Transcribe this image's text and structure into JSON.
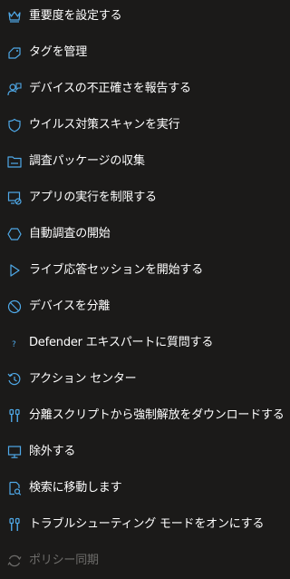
{
  "accent_color": "#4fa9e8",
  "menu": {
    "items": [
      {
        "label": "重要度を設定する",
        "icon": "crown-icon"
      },
      {
        "label": "タグを管理",
        "icon": "tag-icon"
      },
      {
        "label": "デバイスの不正確さを報告する",
        "icon": "report-user-icon"
      },
      {
        "label": "ウイルス対策スキャンを実行",
        "icon": "shield-icon"
      },
      {
        "label": "調査パッケージの収集",
        "icon": "folder-icon"
      },
      {
        "label": "アプリの実行を制限する",
        "icon": "restrict-app-icon"
      },
      {
        "label": "自動調査の開始",
        "icon": "hexagon-icon"
      },
      {
        "label": "ライブ応答セッションを開始する",
        "icon": "play-icon"
      },
      {
        "label": "デバイスを分離",
        "icon": "block-icon"
      },
      {
        "label": "Defender エキスパートに質問する",
        "icon": "question-icon"
      },
      {
        "label": "アクション センター",
        "icon": "history-icon"
      },
      {
        "label": "分離スクリプトから強制解放をダウンロードする",
        "icon": "script-icon"
      },
      {
        "label": "除外する",
        "icon": "monitor-icon"
      },
      {
        "label": "検索に移動します",
        "icon": "search-doc-icon"
      },
      {
        "label": "トラブルシューティング モードをオンにする",
        "icon": "troubleshoot-icon"
      },
      {
        "label": "ポリシー同期",
        "icon": "sync-icon",
        "disabled": true
      }
    ]
  }
}
